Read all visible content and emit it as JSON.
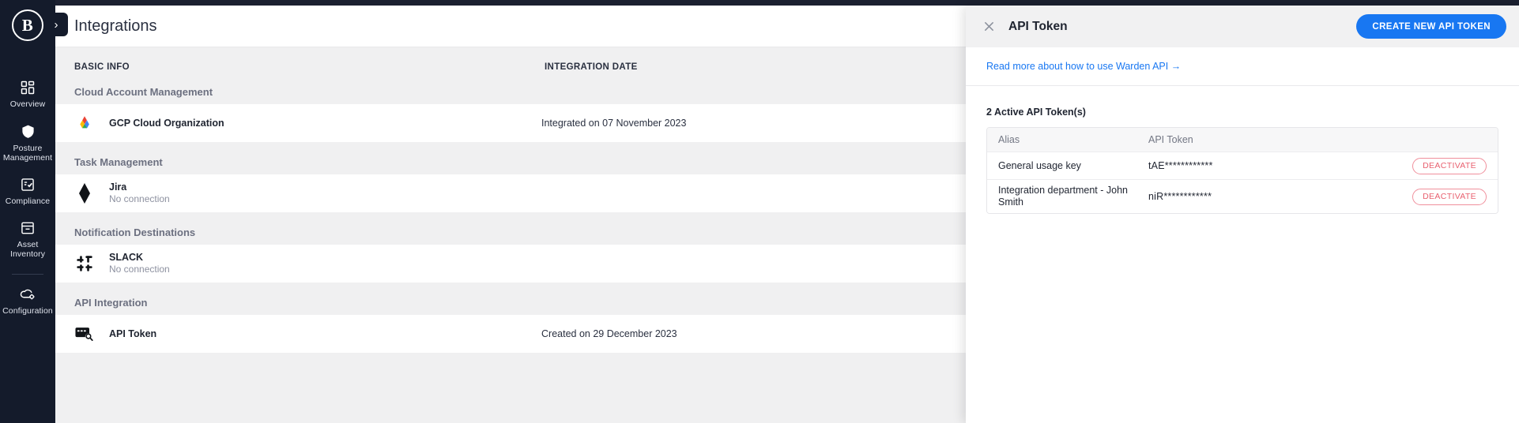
{
  "sidebar": {
    "logo_text": "B",
    "toggle_icon": "chevron-right-icon",
    "items": [
      {
        "label": "Overview",
        "icon": "grid-icon"
      },
      {
        "label": "Posture Management",
        "icon": "shield-icon"
      },
      {
        "label": "Compliance",
        "icon": "checklist-icon"
      },
      {
        "label": "Asset Inventory",
        "icon": "archive-box-icon"
      },
      {
        "label": "Configuration",
        "icon": "cloud-gear-icon"
      }
    ]
  },
  "header": {
    "title": "Integrations"
  },
  "main": {
    "columns": {
      "basic_info": "BASIC INFO",
      "integration_date": "INTEGRATION DATE"
    },
    "groups": [
      {
        "label": "Cloud Account Management",
        "rows": [
          {
            "icon": "gcp-icon",
            "name": "GCP Cloud Organization",
            "sub": "",
            "date": "Integrated on 07 November 2023"
          }
        ]
      },
      {
        "label": "Task Management",
        "rows": [
          {
            "icon": "jira-icon",
            "name": "Jira",
            "sub": "No connection",
            "date": ""
          }
        ]
      },
      {
        "label": "Notification Destinations",
        "rows": [
          {
            "icon": "slack-icon",
            "name": "SLACK",
            "sub": "No connection",
            "date": ""
          }
        ]
      },
      {
        "label": "API Integration",
        "rows": [
          {
            "icon": "api-token-icon",
            "name": "API Token",
            "sub": "",
            "date": "Created on 29 December 2023"
          }
        ]
      }
    ]
  },
  "drawer": {
    "close_icon": "close-icon",
    "title": "API Token",
    "cta_label": "CREATE NEW API TOKEN",
    "doc_link": "Read more about how to use Warden API →",
    "token_count_label": "2 Active API Token(s)",
    "table": {
      "headers": {
        "alias": "Alias",
        "token": "API Token",
        "action": ""
      },
      "rows": [
        {
          "alias": "General usage key",
          "token": "tAE************",
          "action_label": "DEACTIVATE"
        },
        {
          "alias": "Integration department - John Smith",
          "token": "niR************",
          "action_label": "DEACTIVATE"
        }
      ]
    }
  },
  "colors": {
    "rail_bg": "#141b2b",
    "accent_blue": "#1877f2",
    "danger": "#e8606f",
    "page_bg": "#f0f0f1"
  }
}
